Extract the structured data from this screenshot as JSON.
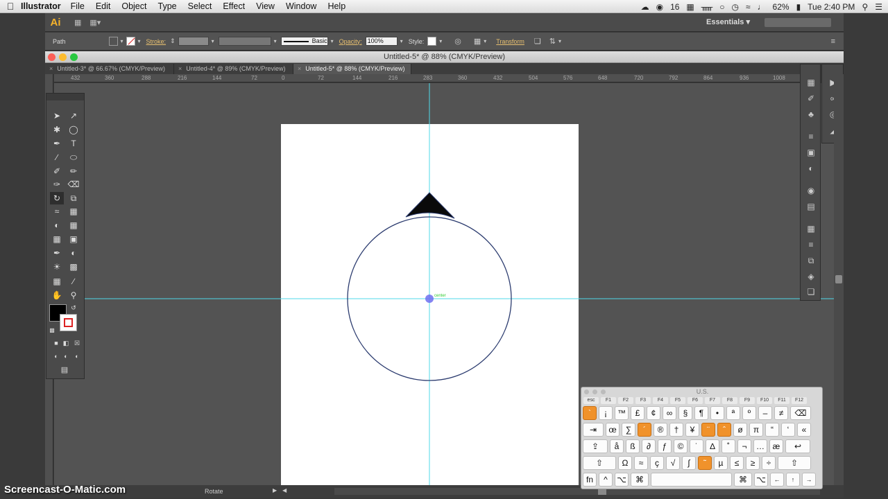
{
  "menubar": {
    "app": "Illustrator",
    "items": [
      "File",
      "Edit",
      "Object",
      "Type",
      "Select",
      "Effect",
      "View",
      "Window",
      "Help"
    ],
    "badge_count": "16",
    "battery": "62%",
    "clock": "Tue 2:40 PM"
  },
  "appbar": {
    "logo": "Ai",
    "workspace": "Essentials"
  },
  "controlbar": {
    "selection_label": "Path",
    "stroke_label": "Stroke:",
    "brush_label": "Basic",
    "opacity_label": "Opacity:",
    "opacity_value": "100%",
    "style_label": "Style:",
    "transform_label": "Transform"
  },
  "document": {
    "window_title": "Untitled-5* @ 88% (CMYK/Preview)",
    "tabs": [
      {
        "label": "Untitled-3* @ 66.67% (CMYK/Preview)"
      },
      {
        "label": "Untitled-4* @ 89% (CMYK/Preview)"
      },
      {
        "label": "Untitled-5* @ 88% (CMYK/Preview)"
      }
    ]
  },
  "ruler": {
    "ticks": [
      "432",
      "360",
      "288",
      "216",
      "144",
      "72",
      "0",
      "72",
      "144",
      "216",
      "283",
      "360",
      "432",
      "504",
      "576",
      "648",
      "720",
      "792",
      "864",
      "936",
      "1008"
    ]
  },
  "canvas": {
    "center_label": "center"
  },
  "status": {
    "tool": "Rotate"
  },
  "watermark": "Screencast-O-Matic.com",
  "keyboard": {
    "title": "U.S.",
    "fkeys": [
      "esc",
      "F1",
      "F2",
      "F3",
      "F4",
      "F5",
      "F6",
      "F7",
      "F8",
      "F9",
      "F10",
      "F11",
      "F12"
    ],
    "row1": [
      "`",
      "¡",
      "™",
      "£",
      "¢",
      "∞",
      "§",
      "¶",
      "•",
      "ª",
      "º",
      "–",
      "≠",
      "⌫"
    ],
    "row2": [
      "⇥",
      "œ",
      "∑",
      "´",
      "®",
      "†",
      "¥",
      "¨",
      "ˆ",
      "ø",
      "π",
      "“",
      "‘",
      "«"
    ],
    "row3": [
      "⇪",
      "å",
      "ß",
      "∂",
      "ƒ",
      "©",
      "˙",
      "∆",
      "˚",
      "¬",
      "…",
      "æ",
      "↩"
    ],
    "row4": [
      "⇧",
      "Ω",
      "≈",
      "ç",
      "√",
      "∫",
      "˜",
      "µ",
      "≤",
      "≥",
      "÷",
      "⇧"
    ],
    "row5": [
      "fn",
      "^",
      "⌥",
      "⌘",
      "",
      "⌘",
      "⌥",
      "←",
      "↑",
      "→"
    ]
  },
  "colors": {
    "guide": "#4fd8e8",
    "accent_key": "#f0922b",
    "logo": "#f7b32b"
  }
}
